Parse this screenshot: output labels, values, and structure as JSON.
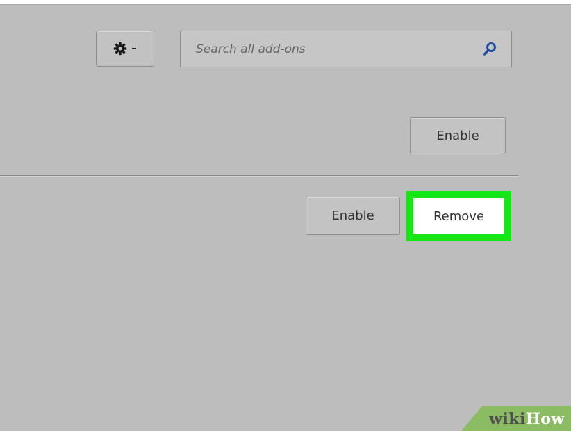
{
  "toolbar": {
    "gear_icon": "gear-icon",
    "dropdown_icon": "caret-down-icon"
  },
  "search": {
    "placeholder": "Search all add-ons",
    "value": "",
    "icon": "search-icon",
    "icon_color": "#1f4fa3"
  },
  "addons": [
    {
      "enable_label": "Enable"
    },
    {
      "enable_label": "Enable",
      "remove_label": "Remove"
    }
  ],
  "highlight": {
    "color": "#14e714"
  },
  "watermark": {
    "part1": "wiki",
    "part2": "How",
    "color": "#8bbb62"
  }
}
